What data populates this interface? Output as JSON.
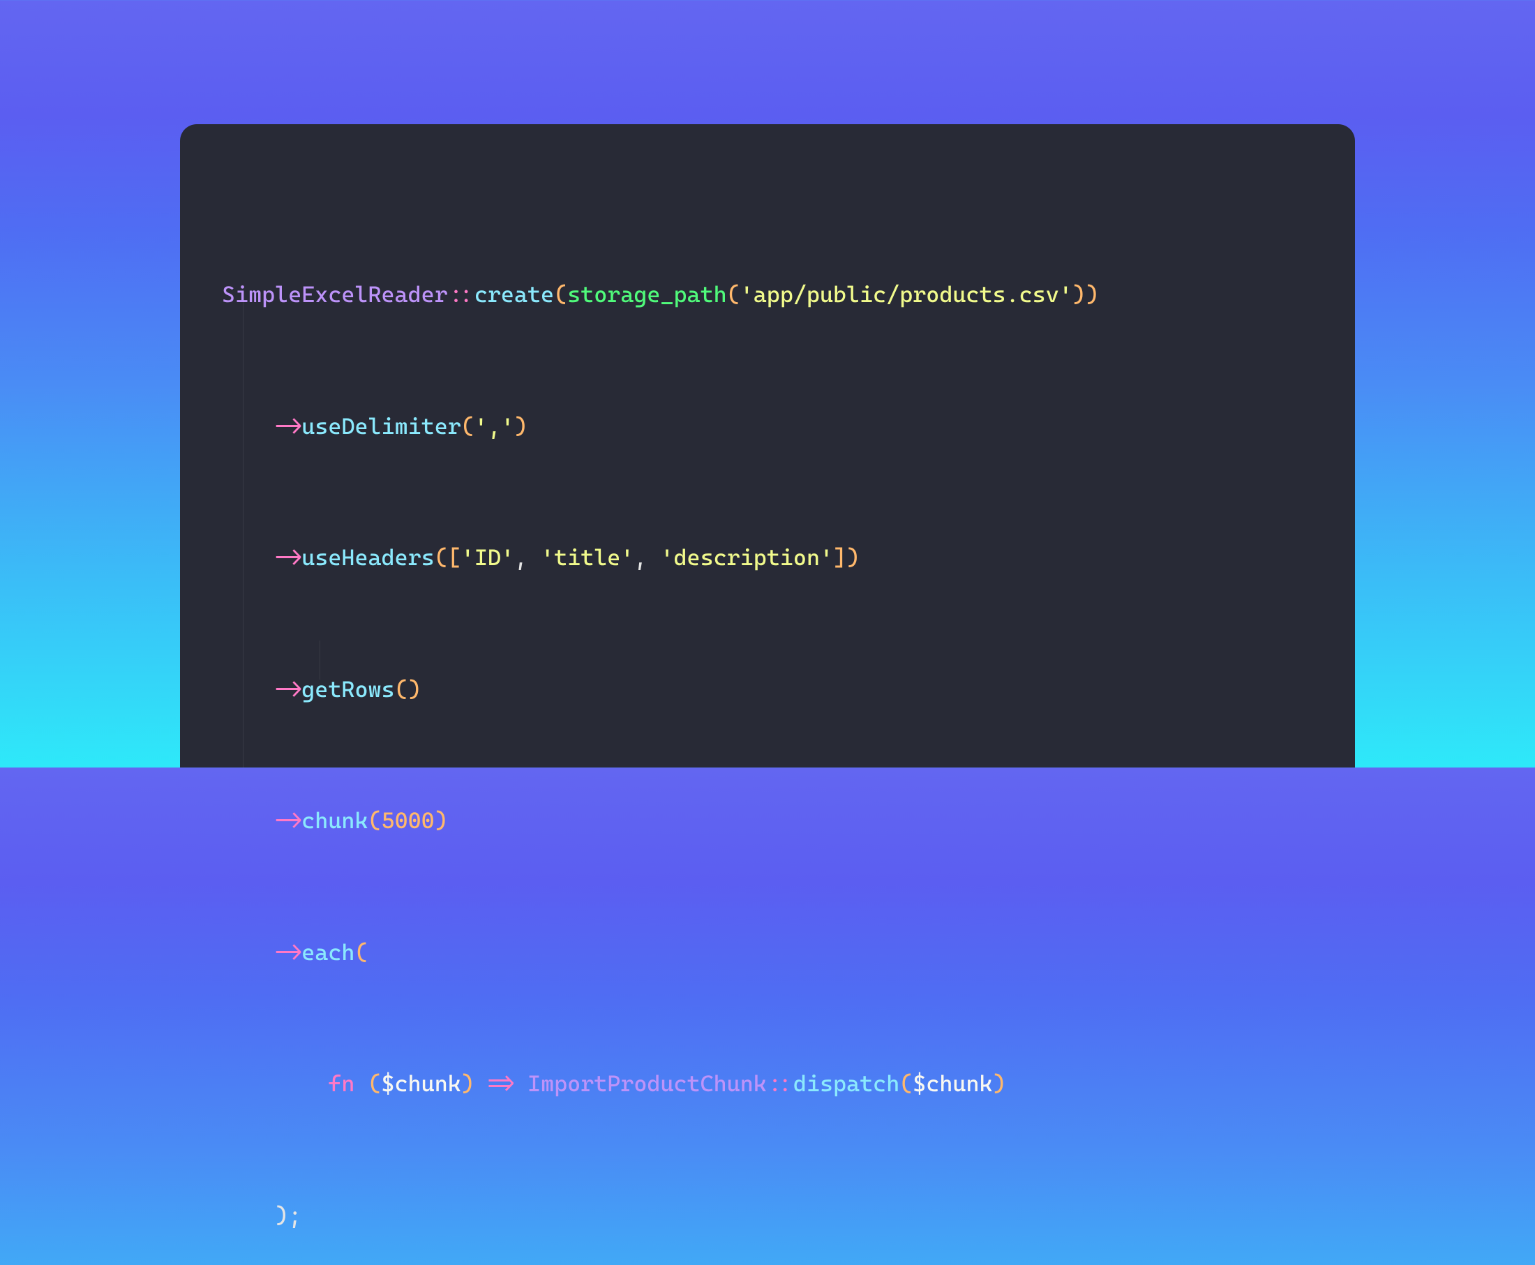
{
  "code": {
    "class1": "SimpleExcelReader",
    "sep": "::",
    "create": "create",
    "storage_path": "storage_path",
    "path_str": "'app/public/products.csv'",
    "arrow": "->",
    "useDelimiter": "useDelimiter",
    "delim_str": "','",
    "useHeaders": "useHeaders",
    "hdr1": "'ID'",
    "hdr2": "'title'",
    "hdr3": "'description'",
    "getRows": "getRows",
    "chunk": "chunk",
    "chunk_num": "5000",
    "each": "each",
    "fn": "fn",
    "var_chunk": "$chunk",
    "fat_arrow": "=>",
    "class2": "ImportProductChunk",
    "dispatch": "dispatch",
    "lp": "(",
    "rp": ")",
    "lb": "[",
    "rb": "]",
    "comma": ", ",
    "semi": ");"
  }
}
